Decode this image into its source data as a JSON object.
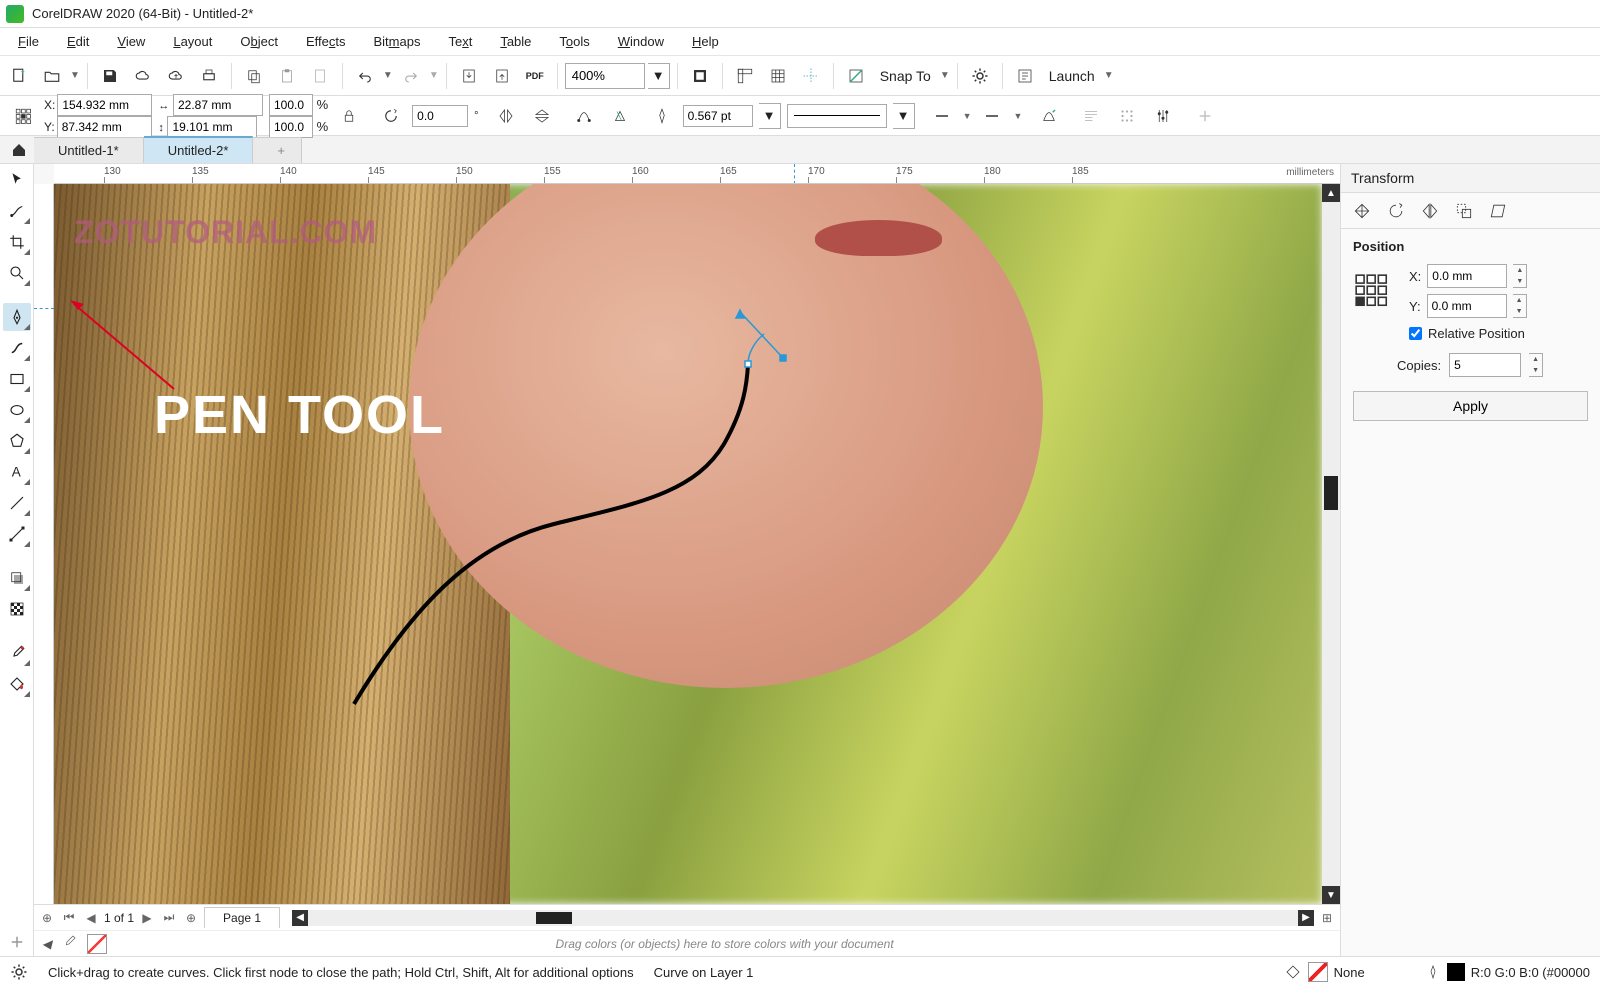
{
  "title": "CorelDRAW 2020 (64-Bit) - Untitled-2*",
  "menu": [
    "File",
    "Edit",
    "View",
    "Layout",
    "Object",
    "Effects",
    "Bitmaps",
    "Text",
    "Table",
    "Tools",
    "Window",
    "Help"
  ],
  "toolbar": {
    "zoom": "400%",
    "snap": "Snap To",
    "launch": "Launch"
  },
  "propbar": {
    "x_label": "X:",
    "y_label": "Y:",
    "x": "154.932 mm",
    "y": "87.342 mm",
    "w": "22.87 mm",
    "h": "19.101 mm",
    "sx": "100.0",
    "sy": "100.0",
    "pct": "%",
    "rot": "0.0",
    "outline": "0.567 pt"
  },
  "tabs": {
    "t1": "Untitled-1*",
    "t2": "Untitled-2*"
  },
  "ruler": {
    "marks": [
      130,
      135,
      140,
      145,
      150,
      155,
      160,
      165,
      170,
      175,
      180,
      185
    ],
    "unit": "millimeters"
  },
  "canvas": {
    "watermark": "ZOTUTORIAL.COM",
    "label": "PEN TOOL"
  },
  "page_nav": {
    "info": "1 of 1",
    "page": "Page 1"
  },
  "colorstrip": {
    "hint": "Drag colors (or objects) here to store colors with your document"
  },
  "docker": {
    "title": "Transform",
    "section": "Position",
    "x_label": "X:",
    "y_label": "Y:",
    "x": "0.0 mm",
    "y": "0.0 mm",
    "relpos": "Relative Position",
    "copies_label": "Copies:",
    "copies": "5",
    "apply": "Apply"
  },
  "status": {
    "gear_hint": "",
    "hint": "Click+drag to create curves. Click first node to close the path; Hold Ctrl, Shift, Alt for additional options",
    "layer": "Curve on Layer 1",
    "fill": "None",
    "rgb": "R:0 G:0 B:0 (#00000"
  }
}
